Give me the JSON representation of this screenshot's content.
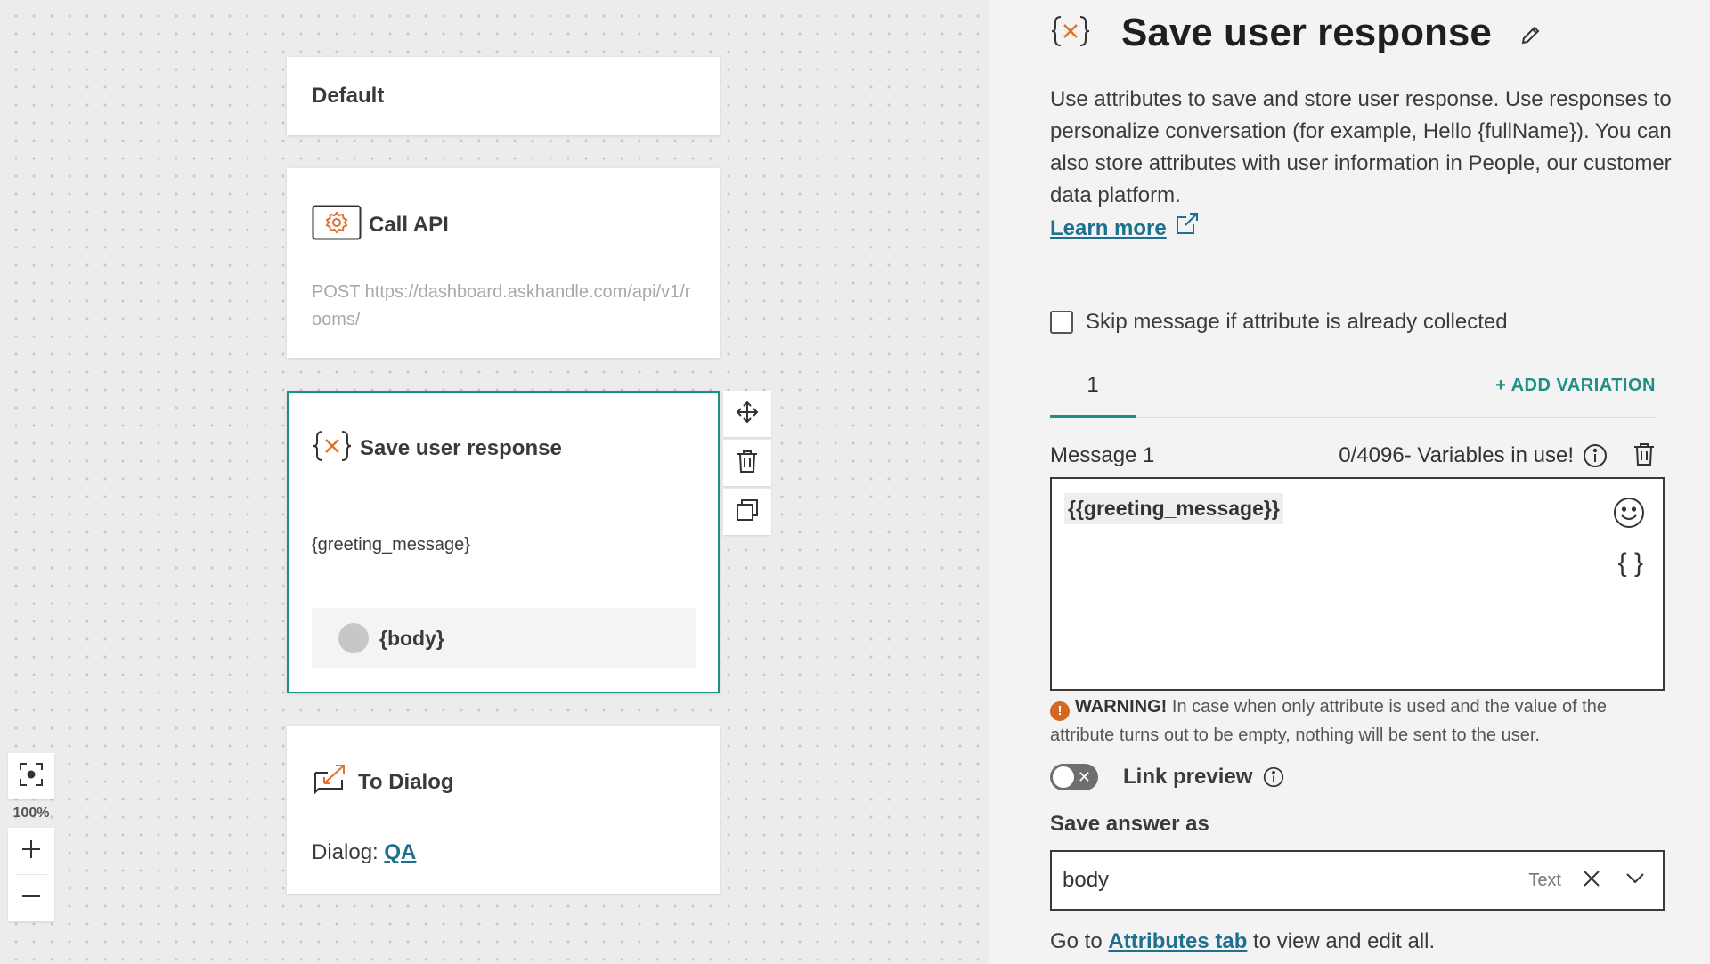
{
  "canvas": {
    "cards": {
      "default": {
        "title": "Default"
      },
      "call_api": {
        "title": "Call API",
        "url": "POST https://dashboard.askhandle.com/api/v1/rooms/",
        "icon": "gear-icon"
      },
      "save_response": {
        "title": "Save user response",
        "variable": "{greeting_message}",
        "chip_label": "{body}",
        "icon": "variable-x-icon"
      },
      "to_dialog": {
        "title": "To Dialog",
        "dialog_prefix": "Dialog:",
        "dialog_link": "QA",
        "icon": "dialog-arrow-icon"
      }
    },
    "node_tools": [
      "move-icon",
      "trash-icon",
      "duplicate-icon"
    ],
    "zoom": {
      "level": "100%",
      "plus": "+",
      "minus": "−"
    }
  },
  "panel": {
    "title": "Save user response",
    "description": "Use attributes to save and store user response. Use responses to personalize conversation (for example, Hello {fullName}). You can also store attributes with user information in People, our customer data platform.",
    "learn_more": "Learn more",
    "skip_label": "Skip message if attribute is already collected",
    "skip_checked": false,
    "tab_label": "1",
    "add_variation": "+ ADD VARIATION",
    "message_label": "Message 1",
    "message_count": "0/4096- Variables in use!",
    "message_token": "{{greeting_message}}",
    "variable_button": "{ }",
    "warning_title": "WARNING!",
    "warning_text": "In case when only attribute is used and the value of the attribute turns out to be empty, nothing will be sent to the user.",
    "warning_icon": "!",
    "link_preview_label": "Link preview",
    "link_preview_on": false,
    "save_answer_label": "Save answer as",
    "save_answer_value": "body",
    "save_answer_type": "Text",
    "goto_prefix": "Go to",
    "goto_link": "Attributes tab",
    "goto_suffix": "to view and edit all."
  },
  "colors": {
    "accent": "#1f8f84",
    "link": "#1f6f8f",
    "icon_orange": "#e0702a",
    "warning": "#d2691e"
  }
}
